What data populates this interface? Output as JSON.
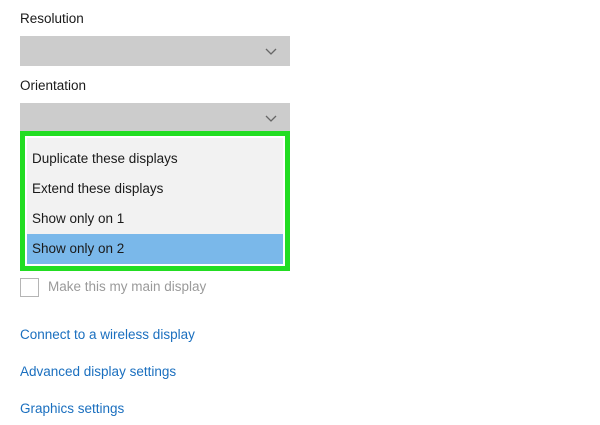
{
  "resolution": {
    "label": "Resolution",
    "value": ""
  },
  "orientation": {
    "label": "Orientation",
    "value": ""
  },
  "display_mode_dropdown": {
    "options": [
      "Duplicate these displays",
      "Extend these displays",
      "Show only on 1",
      "Show only on 2"
    ],
    "selected_option": "Show only on 2",
    "highlight_color": "#22dd22",
    "selected_color": "#7ab8ea"
  },
  "main_display_checkbox": {
    "label": "Make this my main display",
    "checked": false
  },
  "links": {
    "wireless": "Connect to a wireless display",
    "advanced": "Advanced display settings",
    "graphics": "Graphics settings"
  }
}
